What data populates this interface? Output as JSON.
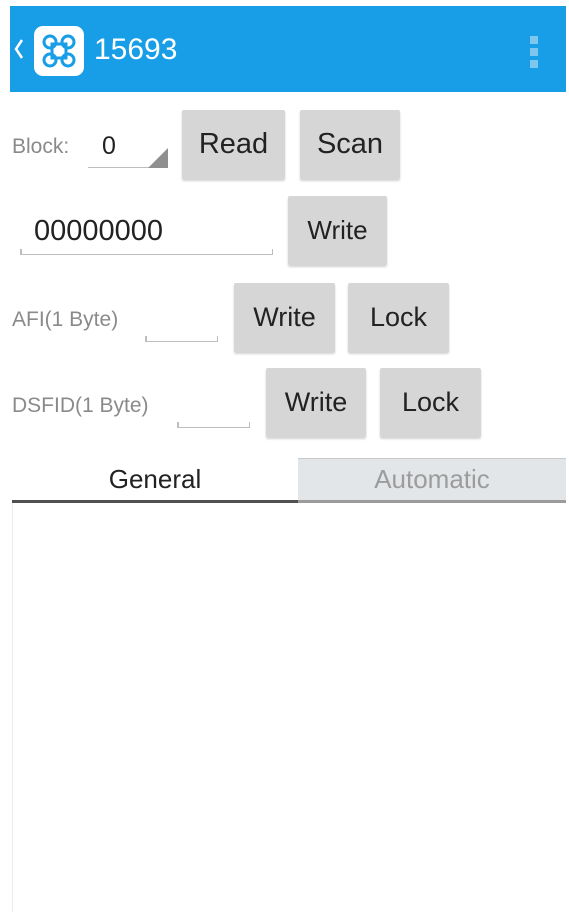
{
  "header": {
    "title": "15693",
    "background_color": "#179ee6",
    "back_icon": "chevron-left-icon",
    "app_icon": "nfc-app-icon",
    "menu_icon": "overflow-menu-icon"
  },
  "block": {
    "label": "Block:",
    "selected_value": "0",
    "read_label": "Read",
    "scan_label": "Scan"
  },
  "data": {
    "value": "00000000",
    "write_label": "Write"
  },
  "afi": {
    "label": "AFI(1 Byte)",
    "value": "",
    "write_label": "Write",
    "lock_label": "Lock"
  },
  "dsfid": {
    "label": "DSFID(1 Byte)",
    "value": "",
    "write_label": "Write",
    "lock_label": "Lock"
  },
  "tabs": [
    {
      "label": "General",
      "selected": true
    },
    {
      "label": "Automatic",
      "selected": false
    }
  ]
}
